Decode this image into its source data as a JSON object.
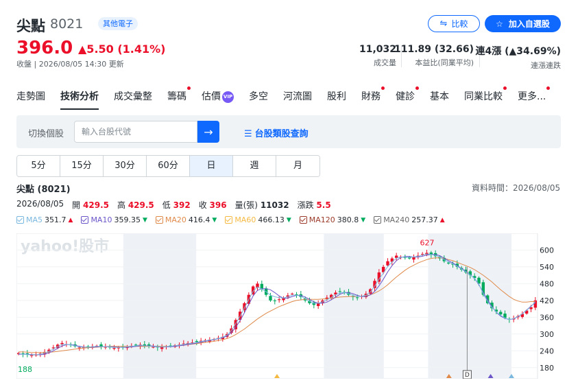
{
  "stock": {
    "name": "尖點",
    "code": "8021",
    "category": "其他電子",
    "price": "396.0",
    "change": "▲5.50 (1.41%)",
    "close_time": "收盤 | 2026/08/05 14:30 更新"
  },
  "buttons": {
    "compare": "比較",
    "watch": "加入自選股"
  },
  "stats": [
    {
      "value": "11,032",
      "label": "成交量"
    },
    {
      "value": "111.89 (32.66)",
      "label": "本益比(同業平均)"
    },
    {
      "value": "連4漲 (▲34.69%)",
      "label": "連漲連跌"
    }
  ],
  "tabs": [
    {
      "label": "走勢圖",
      "dot": false
    },
    {
      "label": "技術分析",
      "dot": false,
      "active": true
    },
    {
      "label": "成交彙整",
      "dot": false
    },
    {
      "label": "籌碼",
      "dot": true
    },
    {
      "label": "估價",
      "dot": false,
      "vip": "VIP"
    },
    {
      "label": "多空",
      "dot": false
    },
    {
      "label": "河流圖",
      "dot": false
    },
    {
      "label": "股利",
      "dot": false
    },
    {
      "label": "財務",
      "dot": true
    },
    {
      "label": "健診",
      "dot": true
    },
    {
      "label": "基本",
      "dot": false
    },
    {
      "label": "同業比較",
      "dot": true
    },
    {
      "label": "更多...",
      "dot": true
    }
  ],
  "search": {
    "label": "切換個股",
    "placeholder": "輸入台股代號",
    "class_link": "台股類股查詢"
  },
  "periods": [
    "5分",
    "15分",
    "30分",
    "60分",
    "日",
    "週",
    "月"
  ],
  "chart_header": {
    "title": "尖點 (8021)",
    "data_time": "資料時間：2026/08/05"
  },
  "ohlc": {
    "date": "2026/08/05",
    "open_label": "開",
    "open": "429.5",
    "high_label": "高",
    "high": "429.5",
    "low_label": "低",
    "low": "392",
    "close_label": "收",
    "close": "396",
    "vol_label": "量(張)",
    "vol": "11032",
    "chg_label": "漲跌",
    "chg": "5.5"
  },
  "legend": [
    {
      "name": "MA5",
      "value": "351.7",
      "dir": "up",
      "color": "#7ab8e0"
    },
    {
      "name": "MA10",
      "value": "359.35",
      "dir": "down",
      "color": "#6b55c9"
    },
    {
      "name": "MA20",
      "value": "416.4",
      "dir": "down",
      "color": "#e08a4a"
    },
    {
      "name": "MA60",
      "value": "466.13",
      "dir": "down",
      "color": "#f5b942"
    },
    {
      "name": "MA120",
      "value": "380.8",
      "dir": "down",
      "color": "#9b3a2a"
    },
    {
      "name": "MA240",
      "value": "257.37",
      "dir": "up",
      "color": "#6a6a6a"
    }
  ],
  "chart_data": {
    "type": "candlestick",
    "watermark": "yahoo!股市",
    "y_ticks": [
      "600",
      "540",
      "480",
      "420",
      "360",
      "300",
      "240",
      "180"
    ],
    "ylim": [
      150,
      650
    ],
    "max_label": "627",
    "min_label": "188",
    "marker": "D",
    "closes": [
      232,
      228,
      226,
      224,
      226,
      230,
      236,
      244,
      252,
      262,
      268,
      264,
      260,
      256,
      252,
      252,
      254,
      256,
      258,
      256,
      254,
      252,
      250,
      252,
      254,
      256,
      258,
      260,
      262,
      258,
      256,
      254,
      252,
      254,
      256,
      258,
      260,
      262,
      266,
      268,
      270,
      272,
      276,
      278,
      280,
      282,
      286,
      290,
      300,
      320,
      350,
      380,
      410,
      440,
      470,
      480,
      460,
      440,
      420,
      418,
      424,
      430,
      438,
      444,
      440,
      432,
      420,
      410,
      404,
      410,
      420,
      430,
      440,
      448,
      452,
      448,
      440,
      432,
      430,
      436,
      444,
      460,
      490,
      520,
      540,
      560,
      570,
      580,
      576,
      572,
      570,
      576,
      580,
      586,
      590,
      584,
      578,
      570,
      560,
      552,
      548,
      540,
      530,
      520,
      510,
      500,
      480,
      440,
      410,
      392,
      380,
      370,
      358,
      352,
      356,
      364,
      372,
      384,
      396,
      420
    ],
    "ma5": [
      228,
      228,
      228,
      227,
      226,
      226,
      228,
      233,
      240,
      249,
      257,
      262,
      262,
      260,
      256,
      254,
      253,
      253,
      254,
      255,
      255,
      255,
      254,
      253,
      252,
      253,
      254,
      256,
      258,
      258,
      258,
      257,
      255,
      254,
      254,
      255,
      256,
      258,
      260,
      263,
      265,
      268,
      271,
      274,
      277,
      280,
      283,
      287,
      293,
      305,
      324,
      348,
      376,
      406,
      436,
      456,
      462,
      462,
      458,
      448,
      436,
      428,
      428,
      434,
      438,
      438,
      432,
      424,
      415,
      410,
      410,
      414,
      422,
      432,
      442,
      448,
      448,
      444,
      438,
      434,
      434,
      440,
      452,
      472,
      496,
      522,
      544,
      562,
      573,
      577,
      577,
      575,
      575,
      578,
      582,
      584,
      584,
      580,
      571,
      562,
      554,
      544,
      534,
      524,
      512,
      498,
      476,
      448,
      422,
      398,
      378,
      364,
      356,
      352,
      354,
      362,
      372,
      386,
      400,
      412
    ],
    "ma20": [
      236,
      236,
      235,
      234,
      234,
      234,
      234,
      235,
      236,
      238,
      240,
      242,
      244,
      246,
      248,
      250,
      251,
      252,
      253,
      254,
      255,
      256,
      256,
      256,
      256,
      256,
      256,
      256,
      256,
      256,
      256,
      256,
      256,
      256,
      256,
      256,
      257,
      258,
      260,
      262,
      264,
      266,
      268,
      270,
      272,
      274,
      277,
      280,
      284,
      290,
      298,
      308,
      318,
      330,
      342,
      354,
      364,
      374,
      382,
      390,
      398,
      404,
      410,
      416,
      420,
      422,
      424,
      424,
      424,
      424,
      425,
      426,
      428,
      430,
      432,
      433,
      434,
      434,
      434,
      435,
      437,
      440,
      446,
      454,
      464,
      476,
      490,
      504,
      516,
      528,
      538,
      546,
      554,
      560,
      566,
      570,
      572,
      572,
      570,
      566,
      562,
      556,
      550,
      544,
      538,
      530,
      520,
      510,
      498,
      486,
      472,
      458,
      446,
      434,
      424,
      418,
      414,
      414,
      416,
      416
    ],
    "highlight_bands": [
      [
        0.205,
        0.345
      ],
      [
        0.59,
        0.705
      ],
      [
        0.79,
        0.95
      ]
    ]
  }
}
